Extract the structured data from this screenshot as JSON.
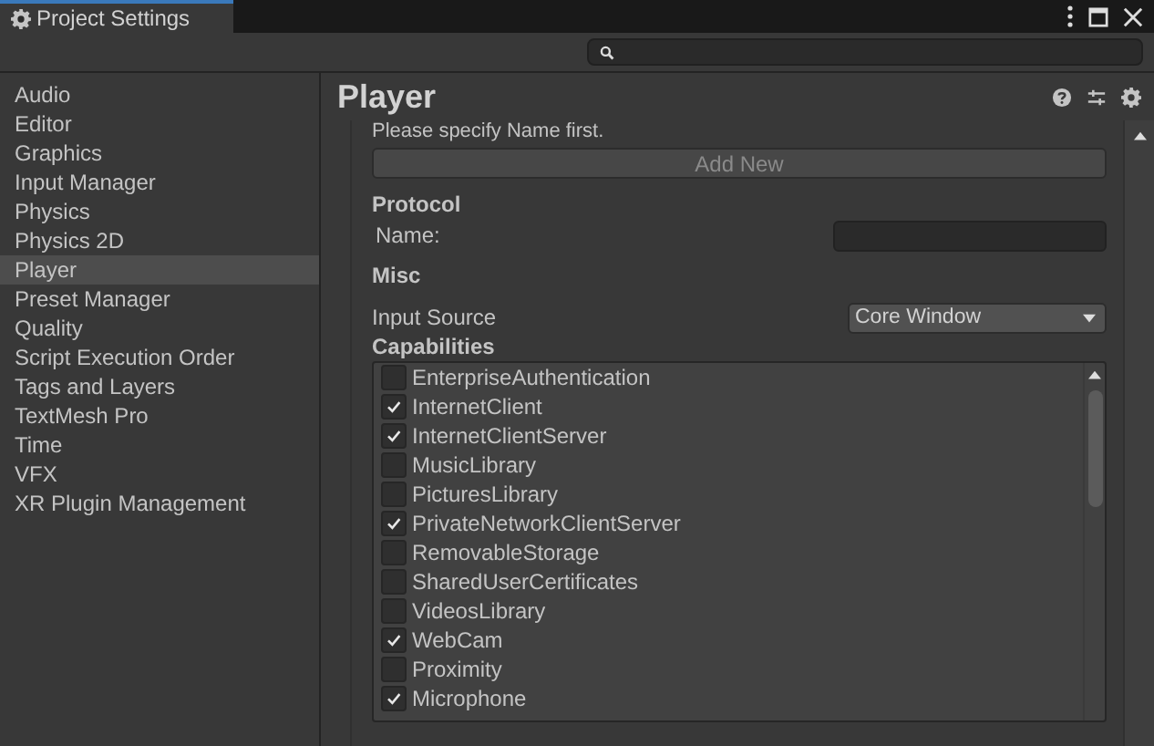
{
  "window": {
    "title": "Project Settings"
  },
  "sidebar": {
    "items": [
      {
        "label": "Audio",
        "selected": false
      },
      {
        "label": "Editor",
        "selected": false
      },
      {
        "label": "Graphics",
        "selected": false
      },
      {
        "label": "Input Manager",
        "selected": false
      },
      {
        "label": "Physics",
        "selected": false
      },
      {
        "label": "Physics 2D",
        "selected": false
      },
      {
        "label": "Player",
        "selected": true
      },
      {
        "label": "Preset Manager",
        "selected": false
      },
      {
        "label": "Quality",
        "selected": false
      },
      {
        "label": "Script Execution Order",
        "selected": false
      },
      {
        "label": "Tags and Layers",
        "selected": false
      },
      {
        "label": "TextMesh Pro",
        "selected": false
      },
      {
        "label": "Time",
        "selected": false
      },
      {
        "label": "VFX",
        "selected": false
      },
      {
        "label": "XR Plugin Management",
        "selected": false
      }
    ]
  },
  "panel": {
    "title": "Player",
    "hint": "Please specify Name first.",
    "add_button": "Add New",
    "protocol": {
      "heading": "Protocol",
      "name_label": "Name:"
    },
    "misc": {
      "heading": "Misc",
      "input_source_label": "Input Source",
      "input_source_value": "Core Window"
    },
    "capabilities": {
      "heading": "Capabilities",
      "items": [
        {
          "label": "EnterpriseAuthentication",
          "checked": false
        },
        {
          "label": "InternetClient",
          "checked": true
        },
        {
          "label": "InternetClientServer",
          "checked": true
        },
        {
          "label": "MusicLibrary",
          "checked": false
        },
        {
          "label": "PicturesLibrary",
          "checked": false
        },
        {
          "label": "PrivateNetworkClientServer",
          "checked": true
        },
        {
          "label": "RemovableStorage",
          "checked": false
        },
        {
          "label": "SharedUserCertificates",
          "checked": false
        },
        {
          "label": "VideosLibrary",
          "checked": false
        },
        {
          "label": "WebCam",
          "checked": true
        },
        {
          "label": "Proximity",
          "checked": false
        },
        {
          "label": "Microphone",
          "checked": true
        }
      ]
    }
  }
}
